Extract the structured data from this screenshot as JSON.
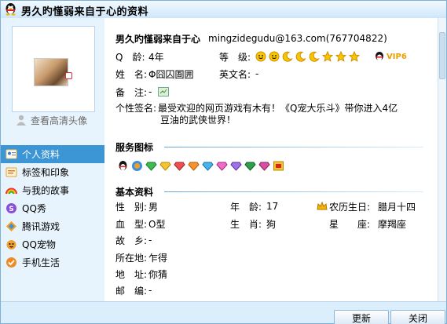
{
  "window": {
    "title": "男久旳慬弱来自于心的资料"
  },
  "left": {
    "hd_link": "查看高清头像",
    "nav": [
      {
        "label": "个人资料",
        "icon": "profile-card-icon",
        "active": true
      },
      {
        "label": "标签和印象",
        "icon": "tag-icon",
        "active": false
      },
      {
        "label": "与我的故事",
        "icon": "rainbow-icon",
        "active": false
      },
      {
        "label": "QQ秀",
        "icon": "qq-show-icon",
        "active": false
      },
      {
        "label": "腾讯游戏",
        "icon": "game-icon",
        "active": false
      },
      {
        "label": "QQ宠物",
        "icon": "pet-icon",
        "active": false
      },
      {
        "label": "手机生活",
        "icon": "phone-life-icon",
        "active": false
      }
    ]
  },
  "profile": {
    "nickname": "男久旳慬弱来自于心",
    "email": "mingzidegudu@163.com(767704822)",
    "qage_label": "Q　龄:",
    "qage_value": "4年",
    "level_label": "等　级:",
    "vip": "VIP6",
    "name_label": "姓　名:",
    "name_value": "Φ囧囚圄囲",
    "english_label": "英文名:",
    "english_value": "-",
    "remark_label": "备　注:",
    "remark_value": "-",
    "signature_label": "个性签名:",
    "signature_line1": "最受欢迎的网页游戏有木有！《Q宠大乐斗》带你进入4亿",
    "signature_line2": "豆油的武侠世界！"
  },
  "sections": {
    "services": "服务图标",
    "basic": "基本资料"
  },
  "basic": {
    "gender_label": "性　别:",
    "gender_value": "男",
    "age_label": "年　龄:",
    "age_value": "17",
    "lunar_label": "农历生日:",
    "lunar_value": "腊月十四",
    "blood_label": "血　型:",
    "blood_value": "O型",
    "zodiac_label": "生　肖:",
    "zodiac_value": "狗",
    "star_label": "星　　座:",
    "star_value": "摩羯座",
    "hometown_label": "故　乡:",
    "hometown_value": "-",
    "location_label": "所在地:",
    "location_value": "乍得",
    "address_label": "地　址:",
    "address_value": "你猜",
    "zip_label": "邮　编:",
    "zip_value": "-"
  },
  "buttons": {
    "refresh": "更新",
    "close": "关闭"
  },
  "colors": {
    "accent": "#3c95d5",
    "title_bg": "#cfe6f8",
    "section_line": "#6aa6d6"
  }
}
